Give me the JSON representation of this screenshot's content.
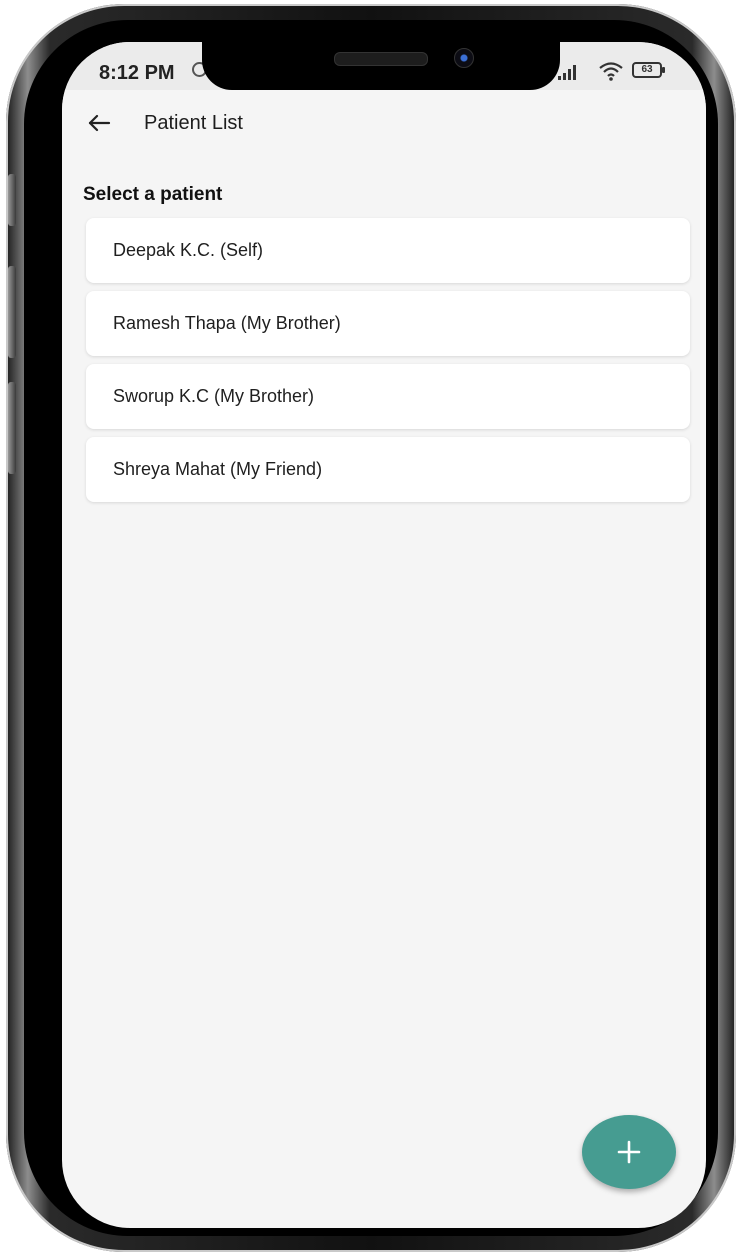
{
  "status_bar": {
    "time": "8:12 PM",
    "battery": "63"
  },
  "app_bar": {
    "title": "Patient List"
  },
  "heading": "Select a patient",
  "patients": [
    {
      "label": "Deepak K.C. (Self)"
    },
    {
      "label": "Ramesh Thapa (My Brother)"
    },
    {
      "label": "Sworup K.C (My Brother)"
    },
    {
      "label": "Shreya Mahat (My Friend)"
    }
  ],
  "icons": {
    "back": "arrow-left",
    "add": "plus",
    "alarm": "alarm-clock",
    "signal": "cell-signal",
    "wifi": "wifi",
    "battery": "battery"
  },
  "colors": {
    "fab": "#469c91",
    "background": "#f5f5f5",
    "card": "#ffffff"
  }
}
